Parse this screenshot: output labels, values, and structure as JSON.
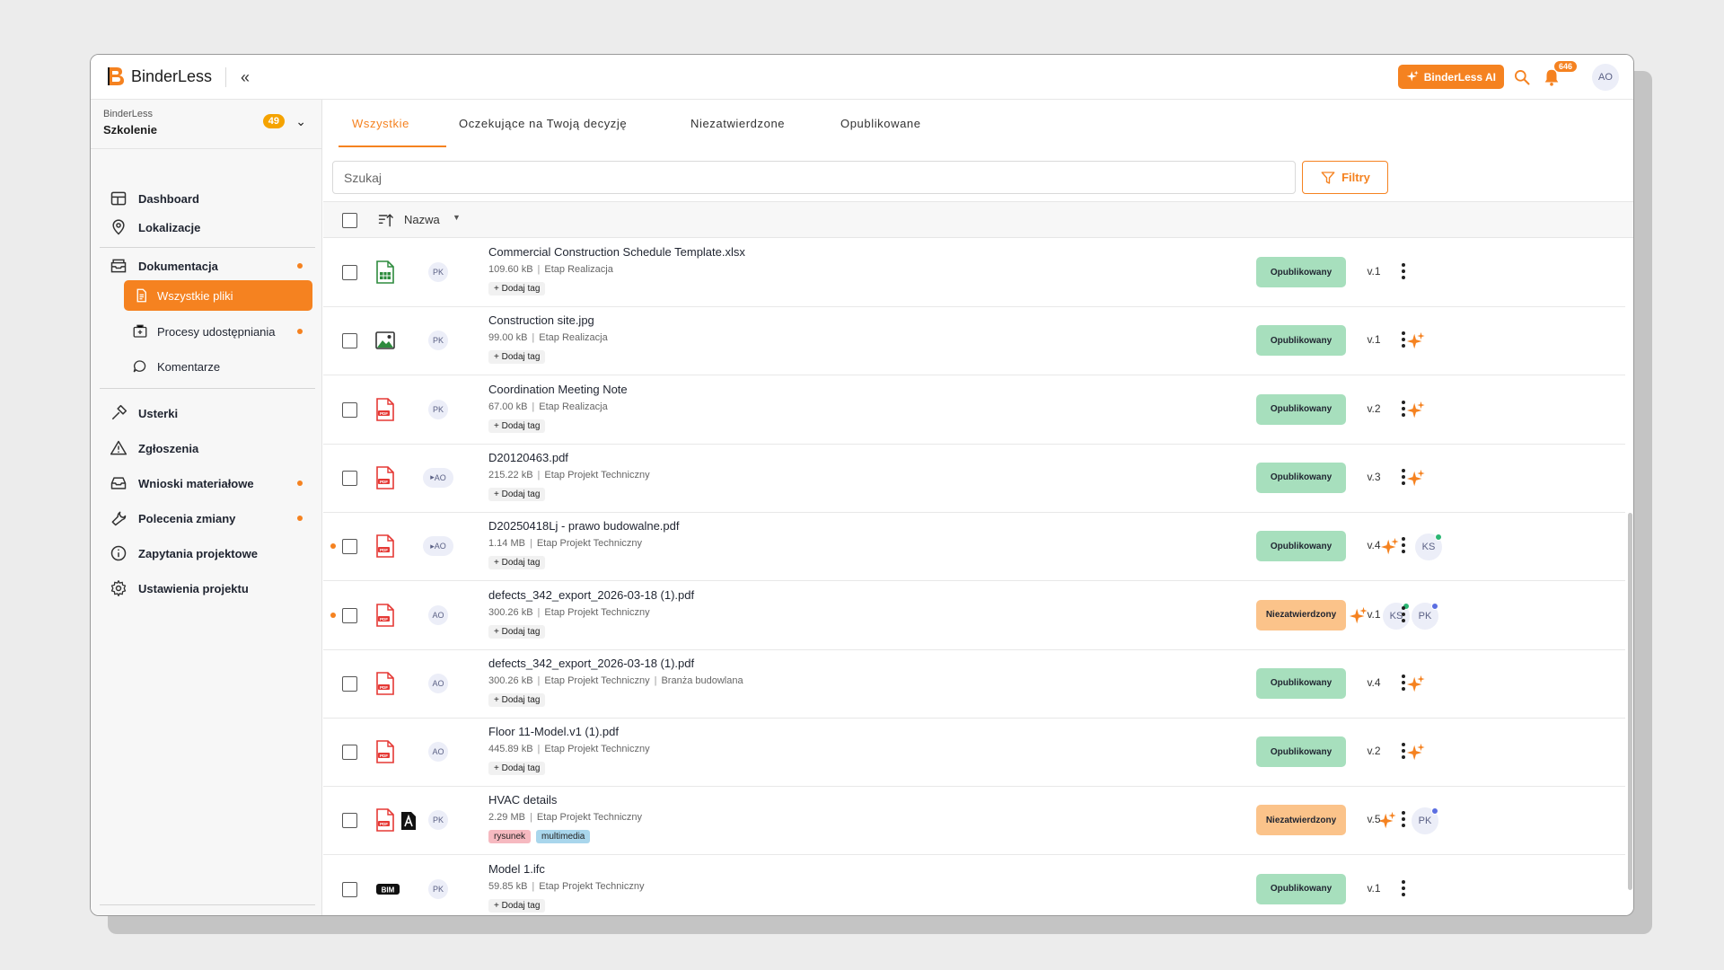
{
  "app": {
    "name": "BinderLess"
  },
  "topbar": {
    "ai_label": "BinderLess AI",
    "notifications": "646",
    "user_initials": "AO"
  },
  "project": {
    "org": "BinderLess",
    "name": "Szkolenie",
    "badge": "49"
  },
  "sidebar": {
    "items": [
      {
        "label": "Dashboard"
      },
      {
        "label": "Lokalizacje"
      },
      {
        "label": "Dokumentacja"
      },
      {
        "label": "Wszystkie pliki"
      },
      {
        "label": "Procesy udostępniania"
      },
      {
        "label": "Komentarze"
      },
      {
        "label": "Usterki"
      },
      {
        "label": "Zgłoszenia"
      },
      {
        "label": "Wnioski materiałowe"
      },
      {
        "label": "Polecenia zmiany"
      },
      {
        "label": "Zapytania projektowe"
      },
      {
        "label": "Ustawienia projektu"
      }
    ]
  },
  "tabs": [
    {
      "label": "Wszystkie"
    },
    {
      "label": "Oczekujące na Twoją decyzję"
    },
    {
      "label": "Niezatwierdzone"
    },
    {
      "label": "Opublikowane"
    }
  ],
  "search": {
    "placeholder": "Szukaj"
  },
  "filters_label": "Filtry",
  "table": {
    "name_header": "Nazwa",
    "add_tag": "+ Dodaj tag"
  },
  "colors": {
    "accent": "#f58220",
    "published": "#a7dfbd",
    "unconfirmed": "#fbc38a"
  },
  "files": [
    {
      "name": "Commercial Construction Schedule Template.xlsx",
      "size": "109.60 kB",
      "stage": "Etap Realizacja",
      "owner": "PK",
      "status": "Opublikowany",
      "version": "v.1"
    },
    {
      "name": "Construction site.jpg",
      "size": "99.00 kB",
      "stage": "Etap Realizacja",
      "owner": "PK",
      "status": "Opublikowany",
      "version": "v.1"
    },
    {
      "name": "Coordination Meeting Note",
      "size": "67.00 kB",
      "stage": "Etap Realizacja",
      "owner": "PK",
      "status": "Opublikowany",
      "version": "v.2"
    },
    {
      "name": "D20120463.pdf",
      "size": "215.22 kB",
      "stage": "Etap Projekt Techniczny",
      "owner": "AO",
      "status": "Opublikowany",
      "version": "v.3"
    },
    {
      "name": "D20250418Lj - prawo budowalne.pdf",
      "size": "1.14 MB",
      "stage": "Etap Projekt Techniczny",
      "owner": "AO",
      "reviewer1": "KS",
      "status": "Opublikowany",
      "version": "v.4"
    },
    {
      "name": "defects_342_export_2026-03-18 (1).pdf",
      "size": "300.26 kB",
      "stage": "Etap Projekt Techniczny",
      "owner": "AO",
      "reviewer1": "KS",
      "reviewer2": "PK",
      "status": "Niezatwierdzony",
      "version": "v.1"
    },
    {
      "name": "defects_342_export_2026-03-18 (1).pdf",
      "size": "300.26 kB",
      "stage": "Etap Projekt Techniczny",
      "branch": "Branża budowlana",
      "owner": "AO",
      "status": "Opublikowany",
      "version": "v.4"
    },
    {
      "name": "Floor 11-Model.v1 (1).pdf",
      "size": "445.89 kB",
      "stage": "Etap Projekt Techniczny",
      "owner": "AO",
      "status": "Opublikowany",
      "version": "v.2"
    },
    {
      "name": "HVAC details",
      "size": "2.29 MB",
      "stage": "Etap Projekt Techniczny",
      "owner": "PK",
      "tags": [
        "rysunek",
        "multimedia"
      ],
      "reviewer1": "PK",
      "status": "Niezatwierdzony",
      "version": "v.5"
    },
    {
      "name": "Model 1.ifc",
      "size": "59.85 kB",
      "stage": "Etap Projekt Techniczny",
      "owner": "PK",
      "status": "Opublikowany",
      "version": "v.1"
    }
  ]
}
